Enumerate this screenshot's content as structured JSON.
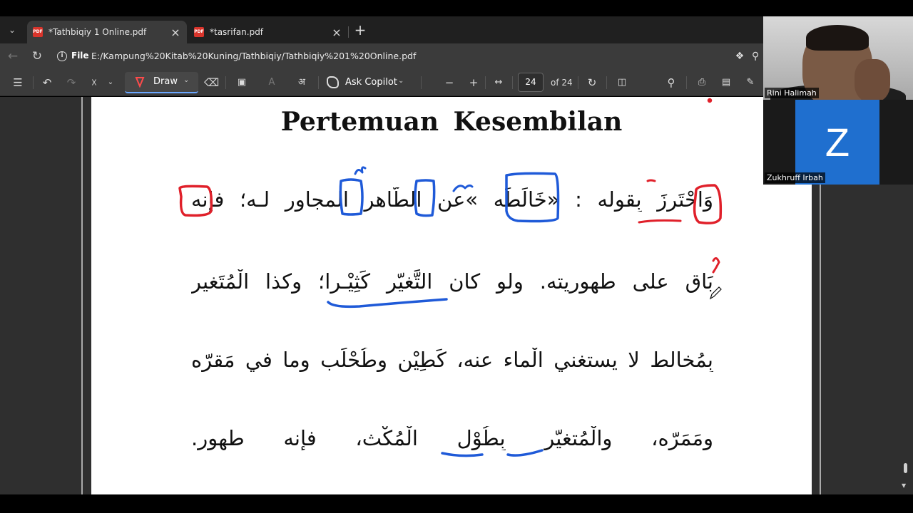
{
  "tabs": [
    {
      "label": "*Tathbiqiy 1 Online.pdf",
      "active": true
    },
    {
      "label": "*tasrifan.pdf",
      "active": false
    }
  ],
  "address": {
    "scheme_label": "File",
    "url": "E:/Kampung%20Kitab%20Kuning/Tathbiqiy/Tathbiqiy%201%20Online.pdf"
  },
  "toolbar": {
    "draw_label": "Draw",
    "copilot_label": "Ask Copilot",
    "current_page": "24",
    "page_total": "of 24"
  },
  "document": {
    "title": "Pertemuan  Kesembilan",
    "lines": [
      "وَاحْتَرزَ بِقوله : «خَالَطَه »عن الطّاهر المجاور لـه؛ فإنه",
      "بَاقٍ على طهوريته.  ولو كان التَّغيّر كَثِيْـرا؛ وكذا الْمُتَغير",
      "بِمُخالط لا يستغني الْماء عنه، كَطِيْن وطُحْلَب وما في مَقرّه",
      "ومَمَرّه، والْمُتغيّر بِطُوْل الْمُكْث،  فإنه طهور."
    ]
  },
  "participants": [
    {
      "name": "Rini Halimah"
    },
    {
      "name": "Zukhruff Irbah",
      "initial": "Z"
    }
  ],
  "colors": {
    "annotation_red": "#e0202a",
    "annotation_blue": "#1f5ad8",
    "participant_tile": "#1f6fcf"
  }
}
